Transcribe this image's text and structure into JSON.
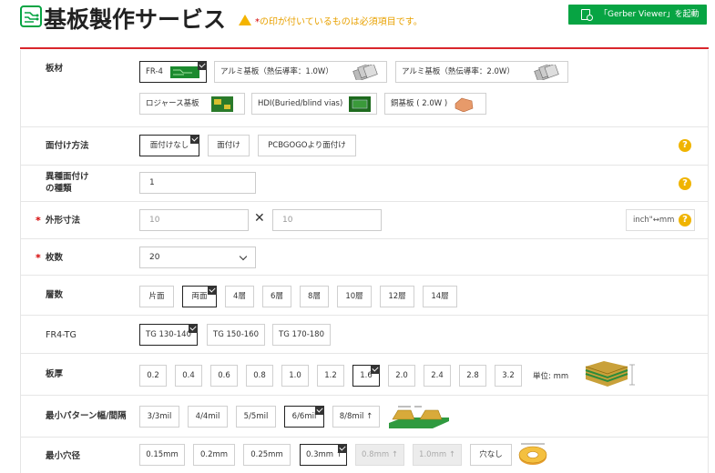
{
  "header": {
    "title": "基板製作サービス",
    "notice_star": "*",
    "notice": "の印が付いているものは必須項目です。",
    "gerber_button": "「Gerber Viewer」を起動"
  },
  "colors": {
    "accent_red": "#d9262c",
    "green": "#07a443",
    "help_yellow": "#f0b400",
    "required": "#d40000"
  },
  "board_material": {
    "label": "板材",
    "options": [
      {
        "label": "FR-4",
        "selected": true
      },
      {
        "label": "アルミ基板（熱伝導率：1.0W）",
        "selected": false
      },
      {
        "label": "アルミ基板（熱伝導率：2.0W）",
        "selected": false
      },
      {
        "label": "ロジャース基板",
        "selected": false
      },
      {
        "label": "HDI(Buried/blind vias)",
        "selected": false
      },
      {
        "label": "銅基板 ( 2.0W )",
        "selected": false
      }
    ]
  },
  "panelization": {
    "label": "面付け方法",
    "options": [
      {
        "label": "面付けなし",
        "selected": true
      },
      {
        "label": "面付け",
        "selected": false
      },
      {
        "label": "PCBGOGOより面付け",
        "selected": false
      }
    ]
  },
  "different_designs": {
    "label_line1": "異種面付け",
    "label_line2": "の種類",
    "value": "1"
  },
  "dimensions": {
    "required_mark": "*",
    "label": "外形寸法",
    "x_placeholder": "10",
    "y_placeholder": "10",
    "times": "✕",
    "unit": "inch\"↔mm"
  },
  "quantity": {
    "required_mark": "*",
    "label": "枚数",
    "value": "20"
  },
  "layers": {
    "label": "層数",
    "options": [
      {
        "label": "片面",
        "selected": false
      },
      {
        "label": "両面",
        "selected": true
      },
      {
        "label": "4層",
        "selected": false
      },
      {
        "label": "6層",
        "selected": false
      },
      {
        "label": "8層",
        "selected": false
      },
      {
        "label": "10層",
        "selected": false
      },
      {
        "label": "12層",
        "selected": false
      },
      {
        "label": "14層",
        "selected": false
      }
    ]
  },
  "tg": {
    "label": "FR4-TG",
    "options": [
      {
        "label": "TG 130-140",
        "selected": true
      },
      {
        "label": "TG 150-160",
        "selected": false
      },
      {
        "label": "TG 170-180",
        "selected": false
      }
    ]
  },
  "thickness": {
    "label": "板厚",
    "unit": "単位: mm",
    "options": [
      {
        "label": "0.2",
        "selected": false
      },
      {
        "label": "0.4",
        "selected": false
      },
      {
        "label": "0.6",
        "selected": false
      },
      {
        "label": "0.8",
        "selected": false
      },
      {
        "label": "1.0",
        "selected": false
      },
      {
        "label": "1.2",
        "selected": false
      },
      {
        "label": "1.6",
        "selected": true
      },
      {
        "label": "2.0",
        "selected": false
      },
      {
        "label": "2.4",
        "selected": false
      },
      {
        "label": "2.8",
        "selected": false
      },
      {
        "label": "3.2",
        "selected": false
      }
    ]
  },
  "trace": {
    "label": "最小パターン幅/間隔",
    "options": [
      {
        "label": "3/3mil",
        "selected": false
      },
      {
        "label": "4/4mil",
        "selected": false
      },
      {
        "label": "5/5mil",
        "selected": false
      },
      {
        "label": "6/6mil",
        "selected": true
      },
      {
        "label": "8/8mil ↑",
        "selected": false
      }
    ]
  },
  "hole": {
    "label": "最小穴径",
    "options": [
      {
        "label": "0.15mm",
        "selected": false,
        "disabled": false
      },
      {
        "label": "0.2mm",
        "selected": false,
        "disabled": false
      },
      {
        "label": "0.25mm",
        "selected": false,
        "disabled": false
      },
      {
        "label": "0.3mm ↑",
        "selected": true,
        "disabled": false
      },
      {
        "label": "0.8mm ↑",
        "selected": false,
        "disabled": true
      },
      {
        "label": "1.0mm ↑",
        "selected": false,
        "disabled": true
      },
      {
        "label": "穴なし",
        "selected": false,
        "disabled": false
      }
    ]
  },
  "help_mark": "?"
}
